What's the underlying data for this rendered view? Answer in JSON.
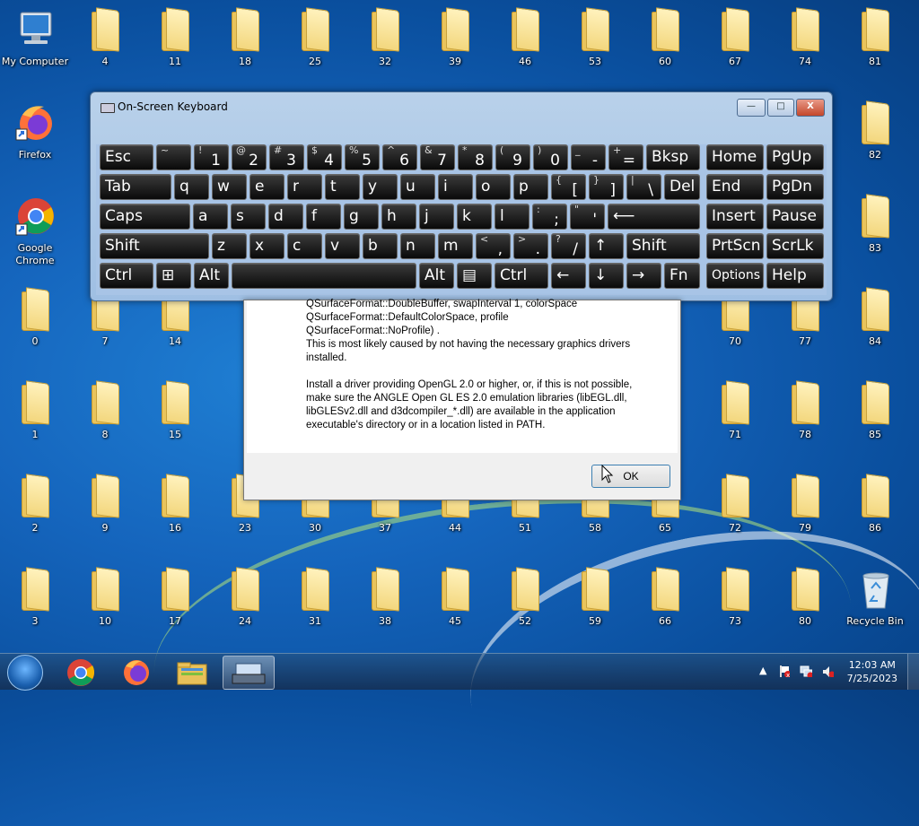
{
  "desktop": {
    "system_icons": [
      {
        "label": "My Computer",
        "icon": "computer-icon"
      },
      {
        "label": "Firefox",
        "icon": "firefox-icon"
      },
      {
        "label": "Google Chrome",
        "icon": "chrome-icon"
      },
      {
        "label": "Recycle Bin",
        "icon": "recycle-bin-icon"
      }
    ],
    "folders": [
      "4",
      "11",
      "18",
      "25",
      "32",
      "39",
      "46",
      "53",
      "60",
      "67",
      "74",
      "81",
      "82",
      "83",
      "0",
      "7",
      "14",
      "70",
      "77",
      "84",
      "1",
      "8",
      "15",
      "71",
      "78",
      "85",
      "2",
      "9",
      "16",
      "23",
      "30",
      "37",
      "44",
      "51",
      "58",
      "65",
      "72",
      "79",
      "86",
      "3",
      "10",
      "17",
      "24",
      "31",
      "38",
      "45",
      "52",
      "59",
      "66",
      "73",
      "80"
    ]
  },
  "osk": {
    "title": "On-Screen Keyboard",
    "controls": {
      "minimize": "—",
      "maximize": "□",
      "close": "X"
    },
    "keys": {
      "esc": "Esc",
      "tilde_hi": "~",
      "tilde_lo": "`",
      "n1_hi": "!",
      "n1": "1",
      "n2_hi": "@",
      "n2": "2",
      "n3_hi": "#",
      "n3": "3",
      "n4_hi": "$",
      "n4": "4",
      "n5_hi": "%",
      "n5": "5",
      "n6_hi": "^",
      "n6": "6",
      "n7_hi": "&",
      "n7": "7",
      "n8_hi": "*",
      "n8": "8",
      "n9_hi": "(",
      "n9": "9",
      "n0_hi": ")",
      "n0": "0",
      "minus_hi": "_",
      "minus": "-",
      "plus_hi": "+",
      "plus": "=",
      "bksp": "Bksp",
      "home": "Home",
      "pgup": "PgUp",
      "tab": "Tab",
      "q": "q",
      "w": "w",
      "e": "e",
      "r": "r",
      "t": "t",
      "y": "y",
      "u": "u",
      "i": "i",
      "o": "o",
      "p": "p",
      "lbr_hi": "{",
      "lbr": "[",
      "rbr_hi": "}",
      "rbr": "]",
      "bsl_hi": "|",
      "bsl": "\\",
      "del": "Del",
      "end": "End",
      "pgdn": "PgDn",
      "caps": "Caps",
      "a": "a",
      "s": "s",
      "d": "d",
      "f": "f",
      "g": "g",
      "h": "h",
      "j": "j",
      "k": "k",
      "l": "l",
      "semi_hi": ":",
      "semi": ";",
      "quote_hi": "\"",
      "quote": "'",
      "enter": "⟵",
      "insert": "Insert",
      "pause": "Pause",
      "shift": "Shift",
      "z": "z",
      "x": "x",
      "c": "c",
      "v": "v",
      "b": "b",
      "n": "n",
      "m": "m",
      "comma_hi": "<",
      "comma": ",",
      "period_hi": ">",
      "period": ".",
      "slash_hi": "?",
      "slash": "/",
      "up": "↑",
      "shift_r": "Shift",
      "prtscn": "PrtScn",
      "scrlk": "ScrLk",
      "ctrl": "Ctrl",
      "win": "⊞",
      "alt": "Alt",
      "alt_r": "Alt",
      "menu": "▤",
      "ctrl_r": "Ctrl",
      "left": "←",
      "down": "↓",
      "right": "→",
      "fn": "Fn",
      "options": "Options",
      "help": "Help"
    }
  },
  "dialog": {
    "message": "QSurfaceFormat::DoubleBuffer, swapInterval 1, colorSpace\nQSurfaceFormat::DefaultColorSpace, profile\nQSurfaceFormat::NoProfile) .\nThis is most likely caused by not having the necessary graphics drivers\ninstalled.\n\nInstall a driver providing OpenGL 2.0 or higher, or, if this is not possible,\nmake sure the ANGLE Open GL ES 2.0 emulation libraries (libEGL.dll,\nlibGLESv2.dll and d3dcompiler_*.dll) are available in the application\nexecutable's directory or in a location listed in PATH.",
    "ok_label": "OK"
  },
  "taskbar": {
    "pinned": [
      "chrome-icon",
      "firefox-icon",
      "explorer-icon",
      "on-screen-keyboard-icon"
    ],
    "tray_arrow": "▲",
    "time": "12:03 AM",
    "date": "7/25/2023"
  }
}
